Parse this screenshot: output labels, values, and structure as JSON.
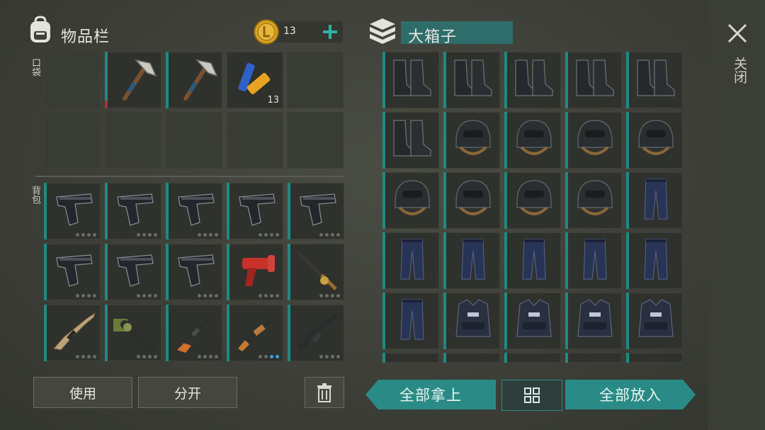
{
  "inventory": {
    "title": "物品栏",
    "coins": "13",
    "add_icon": "plus-icon",
    "pocket_label": "口袋",
    "backpack_label": "背包",
    "pocket_slots": [
      {
        "item": "pickaxe-icon",
        "bar": "red"
      },
      {
        "item": "pickaxe-icon",
        "bar": "teal"
      },
      {
        "item": "batteries-icon",
        "qty": "13"
      }
    ],
    "backpack_slots": [
      {
        "item": "pistol-icon"
      },
      {
        "item": "pistol-icon"
      },
      {
        "item": "pistol-icon"
      },
      {
        "item": "pistol-icon"
      },
      {
        "item": "pistol-icon"
      },
      {
        "item": "pistol-icon"
      },
      {
        "item": "pistol-icon"
      },
      {
        "item": "pistol-icon"
      },
      {
        "item": "flare-gun-icon"
      },
      {
        "item": "fishing-rod-icon"
      },
      {
        "item": "assault-rifle-tan-icon"
      },
      {
        "item": "grenade-launcher-icon"
      },
      {
        "item": "hunting-rifle-icon"
      },
      {
        "item": "shotgun-icon"
      },
      {
        "item": "m16-rifle-icon"
      }
    ],
    "use_label": "使用",
    "split_label": "分开",
    "delete_icon": "trash-icon"
  },
  "box": {
    "title": "大箱子",
    "box_icon": "crate-icon",
    "slots": [
      "boots-icon",
      "boots-icon",
      "boots-icon",
      "boots-icon",
      "boots-icon",
      "boots-icon",
      "helmet-icon",
      "helmet-icon",
      "helmet-icon",
      "helmet-icon",
      "helmet-icon",
      "helmet-icon",
      "helmet-icon",
      "helmet-icon",
      "pants-icon",
      "pants-icon",
      "pants-icon",
      "pants-icon",
      "pants-icon",
      "pants-icon",
      "pants-icon",
      "vest-icon",
      "vest-icon",
      "vest-icon",
      "vest-icon"
    ],
    "take_all_label": "全部拿上",
    "put_all_label": "全部放入",
    "sort_icon": "grid-icon"
  },
  "close": {
    "label": "关闭",
    "icon": "close-x-icon"
  },
  "colors": {
    "accent": "#2a8b86",
    "bar": "#1f8a82",
    "coin": "#d9a322"
  }
}
